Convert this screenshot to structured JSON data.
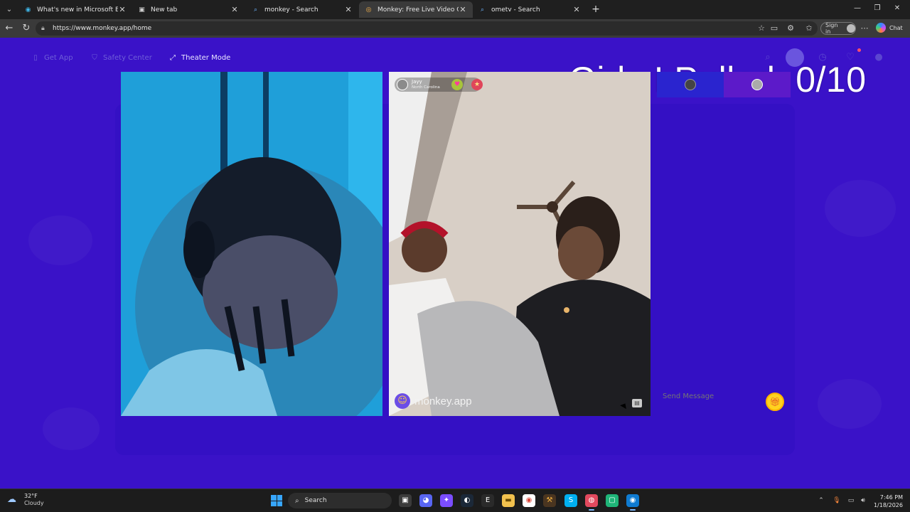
{
  "browser": {
    "tabs": [
      {
        "title": "What's new in Microsoft Edge",
        "icon": "edge-icon",
        "active": false
      },
      {
        "title": "New tab",
        "icon": "newtab-icon",
        "active": false
      },
      {
        "title": "monkey - Search",
        "icon": "search-icon",
        "active": false
      },
      {
        "title": "Monkey: Free Live Video Chat",
        "icon": "monkey-favicon",
        "active": true
      },
      {
        "title": "ometv - Search",
        "icon": "search-icon",
        "active": false
      }
    ],
    "url": "https://www.monkey.app/home",
    "sign_in_label": "Sign in",
    "chat_label": "Chat"
  },
  "header": {
    "get_app": "Get App",
    "safety_center": "Safety Center",
    "theater_mode": "Theater Mode"
  },
  "overlay": {
    "title": "Girls I Pulled: 0/10"
  },
  "peer": {
    "name": "Jayy",
    "location": "North Carolina"
  },
  "watermark": {
    "text": "monkey.app"
  },
  "chat": {
    "placeholder": "Send Message"
  },
  "taskbar": {
    "weather_temp": "32°F",
    "weather_cond": "Cloudy",
    "search_label": "Search",
    "time": "7:46 PM",
    "date": "1/18/2026"
  },
  "colors": {
    "page_bg": "#3a12c8",
    "stage_bg": "#3410c4",
    "accent_gift": "#ffd21f"
  }
}
